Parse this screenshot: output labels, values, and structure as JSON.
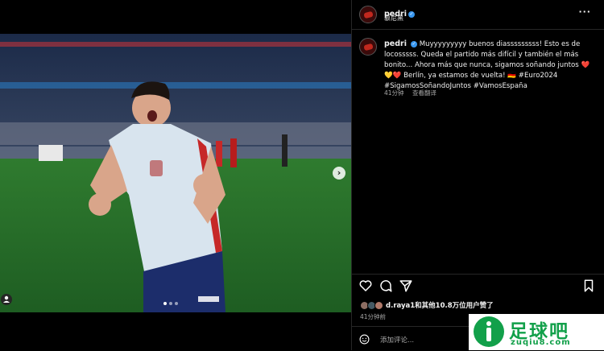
{
  "post": {
    "author": "pedri",
    "location": "慕尼黑",
    "more_icon": "more-horizontal-icon",
    "caption": "Muyyyyyyyyy buenos diasssssssss! Esto es de locosssss. Queda el partido más difícil y también el más bonito... Ahora más que nunca, sigamos soñando juntos ❤️💛❤️ Berlín, ya estamos de vuelta! 🇩🇪 #Euro2024 #SigamosSoñandoJuntos #VamosEspaña",
    "caption_time": "41分钟",
    "see_translation": "查看翻译",
    "likes_text": "d.raya1和其他10.8万位用户赞了",
    "time_ago": "41分钟前",
    "comment_placeholder": "添加评论...",
    "carousel": {
      "index": 1,
      "total": 3
    }
  },
  "icons": [
    "heart-icon",
    "comment-icon",
    "share-icon",
    "bookmark-icon",
    "emoji-icon",
    "user-tag-icon",
    "chevron-right-icon"
  ],
  "colors": {
    "background": "#000000",
    "divider": "#262626",
    "verified": "#3897f0",
    "secondary_text": "#a8a8a8"
  },
  "watermark": {
    "title": "足球吧",
    "url": "zuqiu8.com",
    "color": "#12a04a"
  }
}
